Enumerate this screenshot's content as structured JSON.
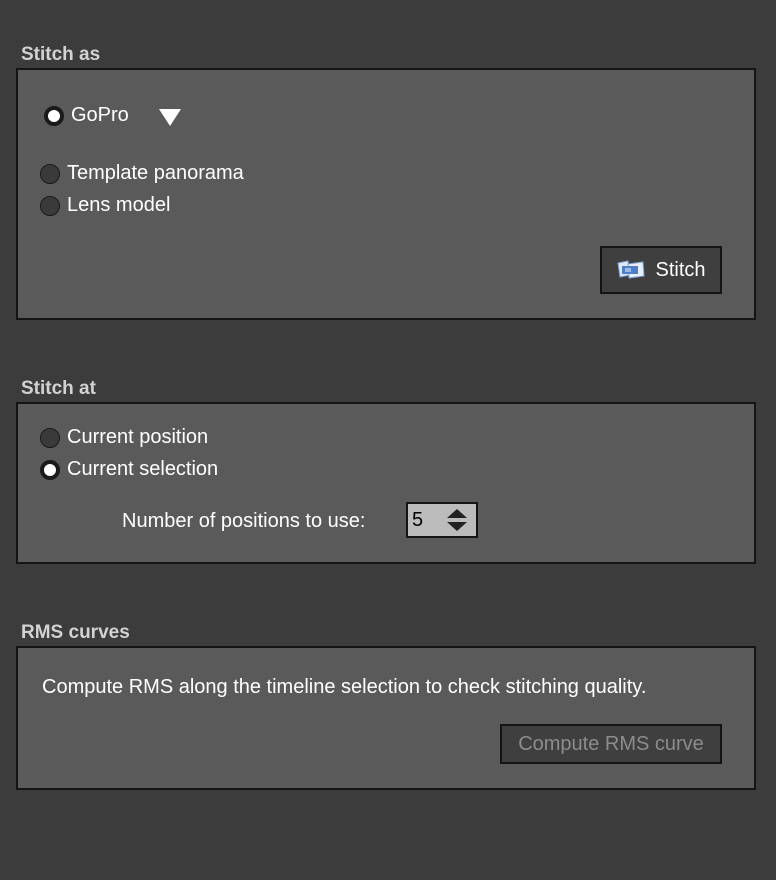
{
  "stitch_as": {
    "title": "Stitch as",
    "options": [
      {
        "label": "GoPro",
        "selected": true
      },
      {
        "label": "Template panorama",
        "selected": false
      },
      {
        "label": "Lens model",
        "selected": false
      }
    ],
    "stitch_button": "Stitch",
    "stitch_icon": "panorama-stitch-icon",
    "dropdown_icon": "triangle-down-icon"
  },
  "stitch_at": {
    "title": "Stitch at",
    "options": [
      {
        "label": "Current position",
        "selected": false
      },
      {
        "label": "Current selection",
        "selected": true
      }
    ],
    "positions_label": "Number of positions to use:",
    "positions_value": "5"
  },
  "rms": {
    "title": "RMS curves",
    "description": "Compute RMS along the timeline selection to check stitching quality.",
    "compute_button": "Compute RMS curve",
    "compute_enabled": false
  },
  "colors": {
    "background": "#3c3c3c",
    "panel": "#5a5a5a",
    "section_title": "#d2d2d2",
    "disabled_text": "#8c8c8c"
  }
}
